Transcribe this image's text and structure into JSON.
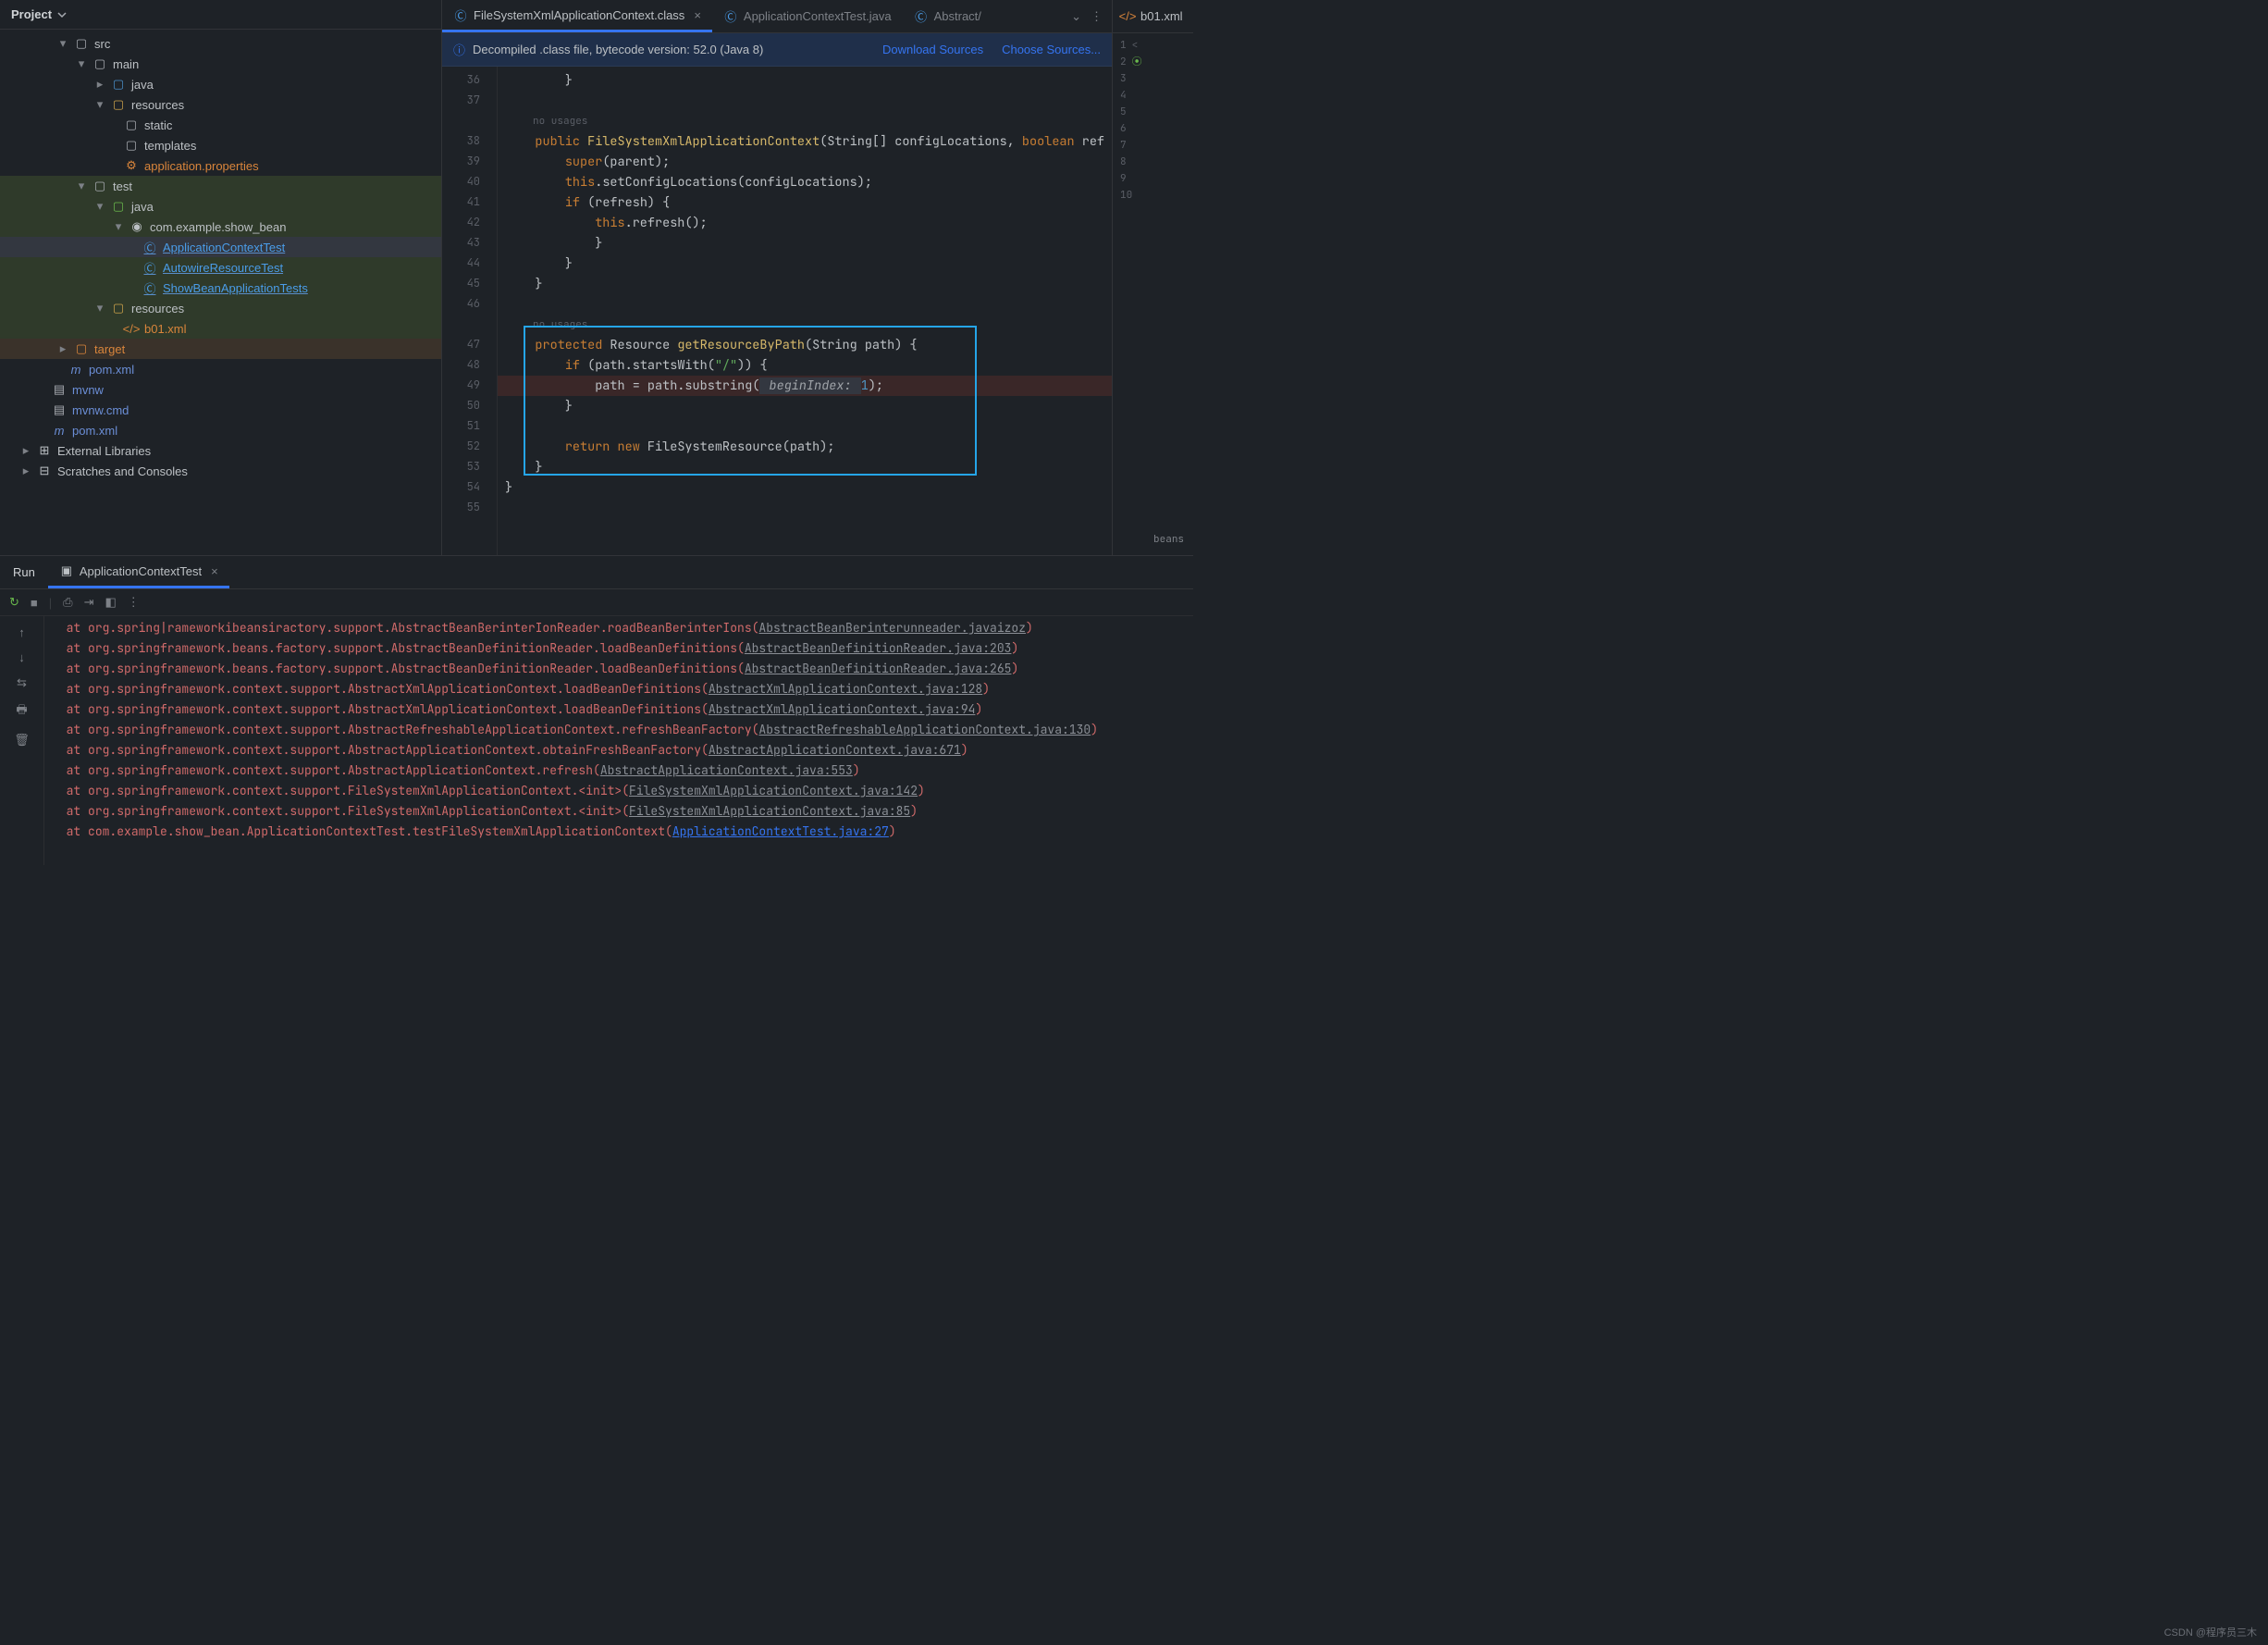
{
  "project": {
    "title": "Project",
    "tree": {
      "src": "src",
      "main": "main",
      "java": "java",
      "resources": "resources",
      "static": "static",
      "templates": "templates",
      "app_props": "application.properties",
      "test": "test",
      "test_java": "java",
      "test_pkg": "com.example.show_bean",
      "test_file1": "ApplicationContextTest",
      "test_file2": "AutowireResourceTest",
      "test_file3": "ShowBeanApplicationTests",
      "test_resources": "resources",
      "b01_xml": "b01.xml",
      "target": "target",
      "pom_xml": "pom.xml",
      "mvnw": "mvnw",
      "mvnw_cmd": "mvnw.cmd",
      "pom_xml2": "pom.xml",
      "ext_libs": "External Libraries",
      "scratches": "Scratches and Consoles"
    }
  },
  "tabs": {
    "t1": "FileSystemXmlApplicationContext.class",
    "t2": "ApplicationContextTest.java",
    "t3": "Abstract/",
    "t4": "b01.xml"
  },
  "banner": {
    "text": "Decompiled .class file, bytecode version: 52.0 (Java 8)",
    "link1": "Download Sources",
    "link2": "Choose Sources..."
  },
  "gutter_lines": [
    "36",
    "37",
    "",
    "38",
    "39",
    "40",
    "41",
    "42",
    "43",
    "44",
    "45",
    "46",
    "",
    "47",
    "48",
    "49",
    "50",
    "51",
    "52",
    "53",
    "54",
    "55"
  ],
  "code": {
    "no_usages": "no usages",
    "l36": "        }",
    "l38_kw": "public",
    "l38_type": " FileSystemXmlApplicationContext",
    "l38_rest1": "(String[] configLocations, ",
    "l38_kw2": "boolean",
    "l38_rest2": " ref",
    "l39_kw": "super",
    "l39_rest": "(parent);",
    "l40_this": "this",
    "l40_rest": ".setConfigLocations(configLocations);",
    "l41_kw": "if",
    "l41_rest": " (refresh) {",
    "l42_this": "this",
    "l42_rest": ".refresh();",
    "l43": "            }",
    "l44": "        }",
    "l45": "    }",
    "l47_kw": "protected",
    "l47_type": " Resource ",
    "l47_method": "getResourceByPath",
    "l47_rest": "(String path) {",
    "l48_kw": "if",
    "l48_rest1": " (path.startsWith(",
    "l48_str": "\"/\"",
    "l48_rest2": ")) {",
    "l49_lhs": "            path = path.substring(",
    "l49_param": " beginIndex: ",
    "l49_num": "1",
    "l49_rest": ");",
    "l50": "        }",
    "l52_kw1": "return",
    "l52_kw2": " new",
    "l52_rest": " FileSystemResource(path);",
    "l53": "    }",
    "l54": "}"
  },
  "marks": {
    "n1": "1",
    "n2": "2",
    "n3": "3",
    "n4": "4",
    "n5": "5",
    "n6": "6",
    "n7": "7",
    "n8": "8",
    "n9": "9",
    "n10": "10",
    "beans": "beans"
  },
  "run": {
    "label": "Run",
    "tab": "ApplicationContextTest"
  },
  "console": [
    {
      "pre": "  at ",
      "txt": "org.spring|rameworkibeansiractory.support.AbstractBeanBerinterIonReader.roadBeanBerinterIons",
      "loc": "AbstractBeanBerinterunneader.javaizoz",
      "suf": ")"
    },
    {
      "pre": "  at ",
      "txt": "org.springframework.beans.factory.support.AbstractBeanDefinitionReader.loadBeanDefinitions",
      "loc": "AbstractBeanDefinitionReader.java:203",
      "suf": ")"
    },
    {
      "pre": "  at ",
      "txt": "org.springframework.beans.factory.support.AbstractBeanDefinitionReader.loadBeanDefinitions",
      "loc": "AbstractBeanDefinitionReader.java:265",
      "suf": ")"
    },
    {
      "pre": "  at ",
      "txt": "org.springframework.context.support.AbstractXmlApplicationContext.loadBeanDefinitions",
      "loc": "AbstractXmlApplicationContext.java:128",
      "suf": ")"
    },
    {
      "pre": "  at ",
      "txt": "org.springframework.context.support.AbstractXmlApplicationContext.loadBeanDefinitions",
      "loc": "AbstractXmlApplicationContext.java:94",
      "suf": ")"
    },
    {
      "pre": "  at ",
      "txt": "org.springframework.context.support.AbstractRefreshableApplicationContext.refreshBeanFactory",
      "loc": "AbstractRefreshableApplicationContext.java:130",
      "suf": ")"
    },
    {
      "pre": "  at ",
      "txt": "org.springframework.context.support.AbstractApplicationContext.obtainFreshBeanFactory",
      "loc": "AbstractApplicationContext.java:671",
      "suf": ")"
    },
    {
      "pre": "  at ",
      "txt": "org.springframework.context.support.AbstractApplicationContext.refresh",
      "loc": "AbstractApplicationContext.java:553",
      "suf": ")"
    },
    {
      "pre": "  at ",
      "txt": "org.springframework.context.support.FileSystemXmlApplicationContext.<init>",
      "loc": "FileSystemXmlApplicationContext.java:142",
      "suf": ")"
    },
    {
      "pre": "  at ",
      "txt": "org.springframework.context.support.FileSystemXmlApplicationContext.<init>",
      "loc": "FileSystemXmlApplicationContext.java:85",
      "suf": ")"
    },
    {
      "pre": "  at ",
      "txt": "com.example.show_bean.ApplicationContextTest.testFileSystemXmlApplicationContext",
      "loc": "ApplicationContextTest.java:27",
      "suf": ")",
      "bright": true
    }
  ],
  "watermark": "CSDN @程序员三木"
}
